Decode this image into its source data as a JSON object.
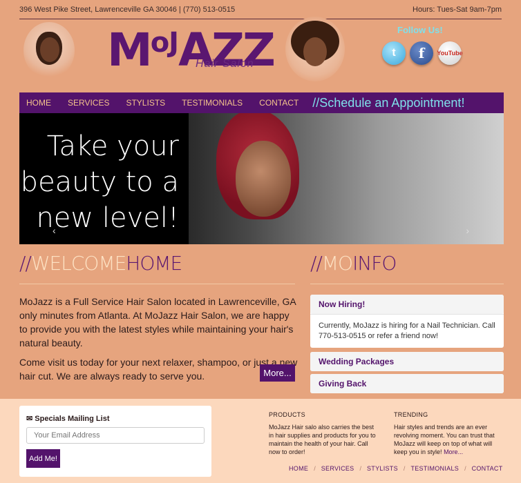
{
  "topbar": {
    "address": "396 West Pike Street, Lawrenceville GA 30046 | (770) 513-0515",
    "hours": "Hours: Tues-Sat 9am-7pm"
  },
  "logo": {
    "main_first": "M",
    "main_small": "oJ",
    "main_rest": "AZZ",
    "sub": "Hair Salon"
  },
  "social": {
    "follow_label": "Follow Us!",
    "twitter_glyph": "t",
    "facebook_glyph": "f",
    "youtube_glyph": "YouTube"
  },
  "nav": {
    "items": [
      "HOME",
      "SERVICES",
      "STYLISTS",
      "TESTIMONIALS",
      "CONTACT"
    ],
    "cta": "//Schedule an Appointment!"
  },
  "hero": {
    "line1": "Take your",
    "line2": "beauty to a",
    "line3": "new level!",
    "prev": "‹",
    "next": "›"
  },
  "welcome": {
    "slashes": "//",
    "part1": "WELCOME",
    "part2": "HOME",
    "p1": "MoJazz is a Full Service Hair Salon located in Lawrenceville, GA only minutes from Atlanta. At MoJazz Hair Salon, we are happy to provide you with the latest styles while maintaining your hair's natural beauty.",
    "p2": "Come visit us today for your next relaxer, shampoo, or just a new hair cut. We are always ready to serve you.",
    "more": "More..."
  },
  "info": {
    "slashes": "//",
    "part1": "MO",
    "part2": "INFO",
    "boxes": [
      {
        "title": "Now Hiring!",
        "body": "Currently, MoJazz is hiring for a Nail Technician. Call 770-513-0515 or refer a friend now!"
      },
      {
        "title": "Wedding Packages"
      },
      {
        "title": "Giving Back"
      }
    ]
  },
  "mailing": {
    "title": "Specials Mailing List",
    "placeholder": "Your Email Address",
    "button": "Add Me!"
  },
  "footer": {
    "products_title": "PRODUCTS",
    "products_body": "MoJazz Hair salo also carries the best in hair supplies and products for you to maintain the health of your hair. Call now to order!",
    "trending_title": "TRENDING",
    "trending_body": "Hair styles and trends are an ever revolving moment. You can trust that MoJazz will keep on top of what will keep you in style!",
    "trending_more": "More...",
    "nav": [
      "HOME",
      "SERVICES",
      "STYLISTS",
      "TESTIMONIALS",
      "CONTACT"
    ]
  },
  "colors": {
    "background": "#e6a47e",
    "brand_purple": "#53136b",
    "accent_cyan": "#7fe0ea",
    "nav_text": "#f4c48c",
    "footer_bg": "#fcd8bd"
  },
  "icons": {
    "mail": "envelope-icon",
    "twitter": "twitter-icon",
    "facebook": "facebook-icon",
    "youtube": "youtube-icon"
  }
}
